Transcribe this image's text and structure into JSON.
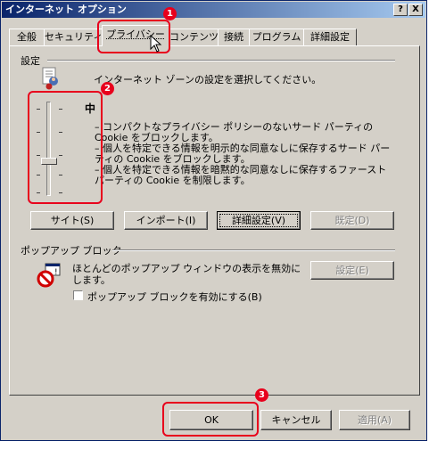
{
  "window": {
    "title": "インターネット オプション"
  },
  "titlebar_buttons": {
    "help": "?",
    "close": "X"
  },
  "tabs": [
    {
      "label": "全般"
    },
    {
      "label": "セキュリティ"
    },
    {
      "label": "プライバシー"
    },
    {
      "label": "コンテンツ"
    },
    {
      "label": "接続"
    },
    {
      "label": "プログラム"
    },
    {
      "label": "詳細設定"
    }
  ],
  "settings": {
    "group_label": "設定",
    "instruction": "インターネット ゾーンの設定を選択してください。",
    "level": "中",
    "slider_level_fraction": 0.5,
    "descriptions": [
      "– コンパクトなプライバシー ポリシーのないサード パーティの Cookie をブロックします。",
      "– 個人を特定できる情報を明示的な同意なしに保存するサード パーティの Cookie をブロックします。",
      "– 個人を特定できる情報を暗黙的な同意なしに保存するファースト パーティの Cookie を制限します。"
    ],
    "buttons": {
      "sites": "サイト(S)",
      "import": "インポート(I)",
      "advanced": "詳細設定(V)",
      "default": "既定(D)"
    }
  },
  "popup": {
    "group_label": "ポップアップ ブロック",
    "description": "ほとんどのポップアップ ウィンドウの表示を無効にします。",
    "settings_button": "設定(E)",
    "checkbox_label": "ポップアップ ブロックを有効にする(B)",
    "checkbox_checked": false
  },
  "footer": {
    "ok": "OK",
    "cancel": "キャンセル",
    "apply": "適用(A)"
  },
  "annotations": [
    "1",
    "2",
    "3"
  ],
  "colors": {
    "annotation_red": "#e8001c",
    "dialog_face": "#d4d0c8",
    "title_bar": "#0a246a"
  }
}
